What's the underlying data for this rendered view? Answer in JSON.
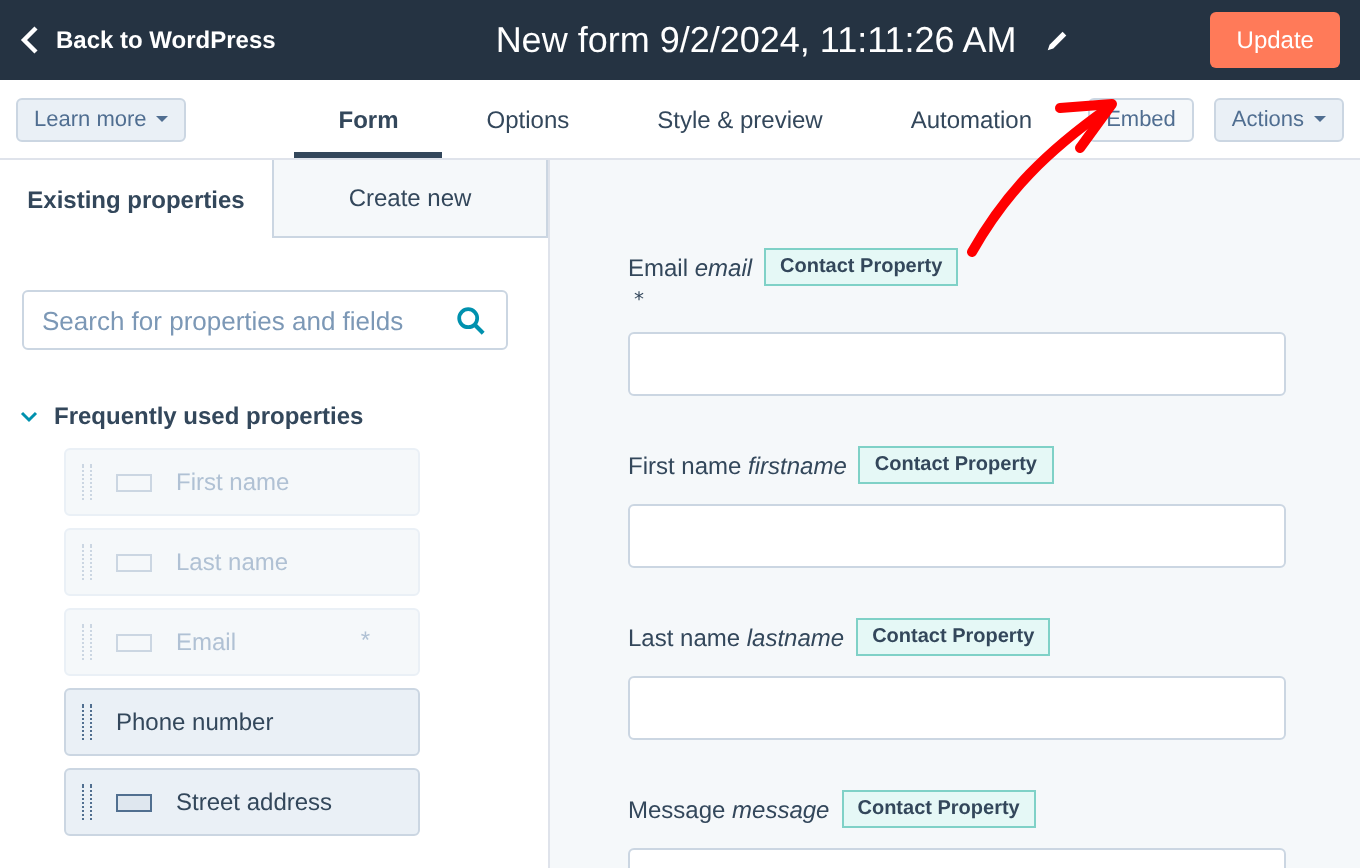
{
  "header": {
    "back": "Back to WordPress",
    "title": "New form 9/2/2024, 11:11:26 AM",
    "update": "Update"
  },
  "toolbar": {
    "learn_more": "Learn more",
    "tabs": [
      {
        "label": "Form",
        "selected": true
      },
      {
        "label": "Options",
        "selected": false
      },
      {
        "label": "Style & preview",
        "selected": false
      },
      {
        "label": "Automation",
        "selected": false
      }
    ],
    "embed": "Embed",
    "actions": "Actions"
  },
  "sidebar": {
    "tabs": [
      {
        "label": "Existing properties",
        "selected": true
      },
      {
        "label": "Create new",
        "selected": false
      }
    ],
    "search": {
      "placeholder": "Search for properties and fields"
    },
    "group": {
      "title": "Frequently used properties",
      "expanded": true,
      "items": [
        {
          "label": "First name",
          "disabled": true,
          "icon": true
        },
        {
          "label": "Last name",
          "disabled": true,
          "icon": true
        },
        {
          "label": "Email",
          "disabled": true,
          "icon": true,
          "required": "*"
        },
        {
          "label": "Phone number",
          "disabled": false,
          "icon": false
        },
        {
          "label": "Street address",
          "disabled": false,
          "icon": true
        }
      ]
    }
  },
  "form": {
    "fields": [
      {
        "label": "Email",
        "name": "email",
        "badge": "Contact Property",
        "required": "*"
      },
      {
        "label": "First name",
        "name": "firstname",
        "badge": "Contact Property"
      },
      {
        "label": "Last name",
        "name": "lastname",
        "badge": "Contact Property"
      },
      {
        "label": "Message",
        "name": "message",
        "badge": "Contact Property"
      }
    ]
  }
}
